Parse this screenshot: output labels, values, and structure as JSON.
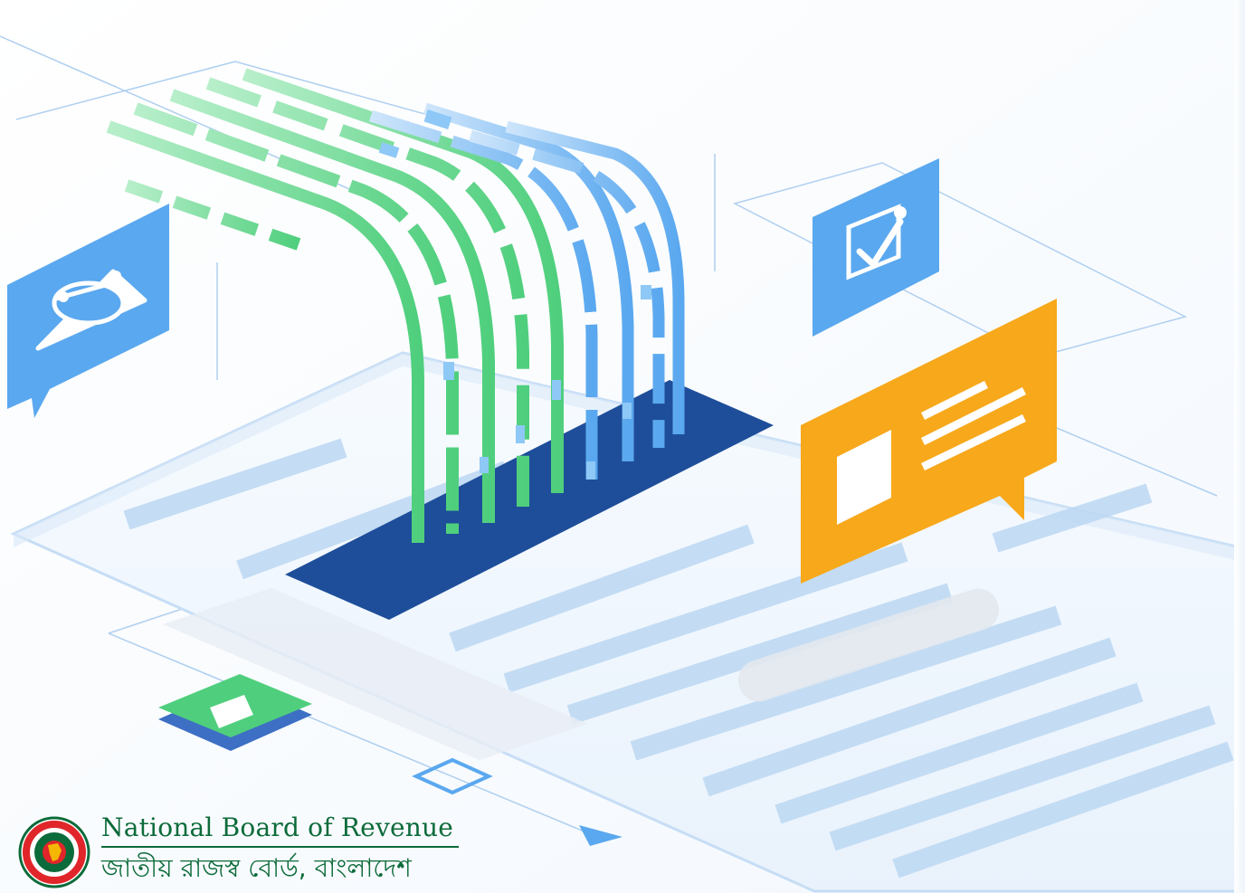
{
  "brand": {
    "org_name_en": "National Board of Revenue",
    "org_name_bn": "জাতীয় রাজস্ব বোর্ড, বাংলাদেশ",
    "seal_text_top": "গণপ্রজাতন্ত্রী বাংলাদেশ",
    "seal_text_bottom": "সরকার"
  },
  "colors": {
    "primary_blue": "#5aa8ef",
    "dark_blue": "#1e4e9a",
    "green": "#4fcf7d",
    "orange": "#f7a81b",
    "line_blue": "#b9d7f4",
    "brand_green": "#0c6b3a",
    "seal_red": "#e0262a"
  },
  "icons": [
    "balance-scale-icon",
    "checkbox-check-icon",
    "document-card-icon",
    "data-stream-icon",
    "scanner-slot-icon",
    "arrow-right-icon"
  ]
}
